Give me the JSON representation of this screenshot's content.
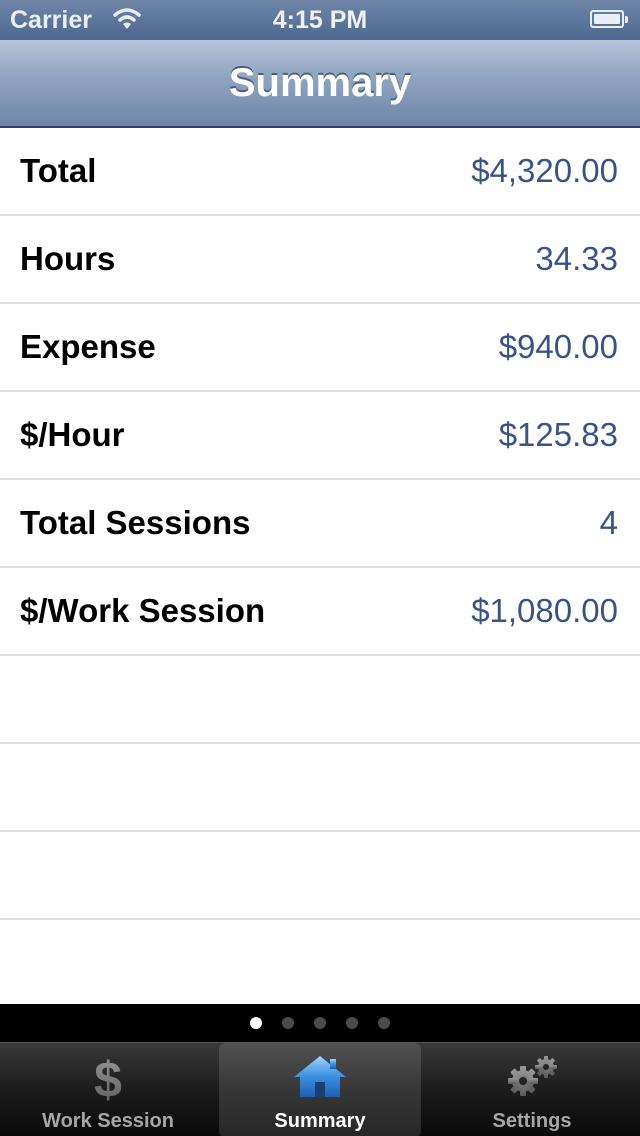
{
  "status_bar": {
    "carrier": "Carrier",
    "time": "4:15 PM"
  },
  "nav_bar": {
    "title": "Summary"
  },
  "summary": {
    "rows": [
      {
        "label": "Total",
        "value": "$4,320.00"
      },
      {
        "label": "Hours",
        "value": "34.33"
      },
      {
        "label": "Expense",
        "value": "$940.00"
      },
      {
        "label": "$/Hour",
        "value": "$125.83"
      },
      {
        "label": "Total Sessions",
        "value": "4"
      },
      {
        "label": "$/Work Session",
        "value": "$1,080.00"
      }
    ]
  },
  "page_control": {
    "page_count": 5,
    "current_page": 1
  },
  "tab_bar": {
    "tabs": [
      {
        "label": "Work Session",
        "icon": "dollar-icon",
        "selected": false
      },
      {
        "label": "Summary",
        "icon": "house-icon",
        "selected": true
      },
      {
        "label": "Settings",
        "icon": "gears-icon",
        "selected": false
      }
    ]
  },
  "colors": {
    "value_text": "#385487",
    "nav_bar": "#8ea3c0",
    "selected_icon": "#3b8fe0"
  }
}
